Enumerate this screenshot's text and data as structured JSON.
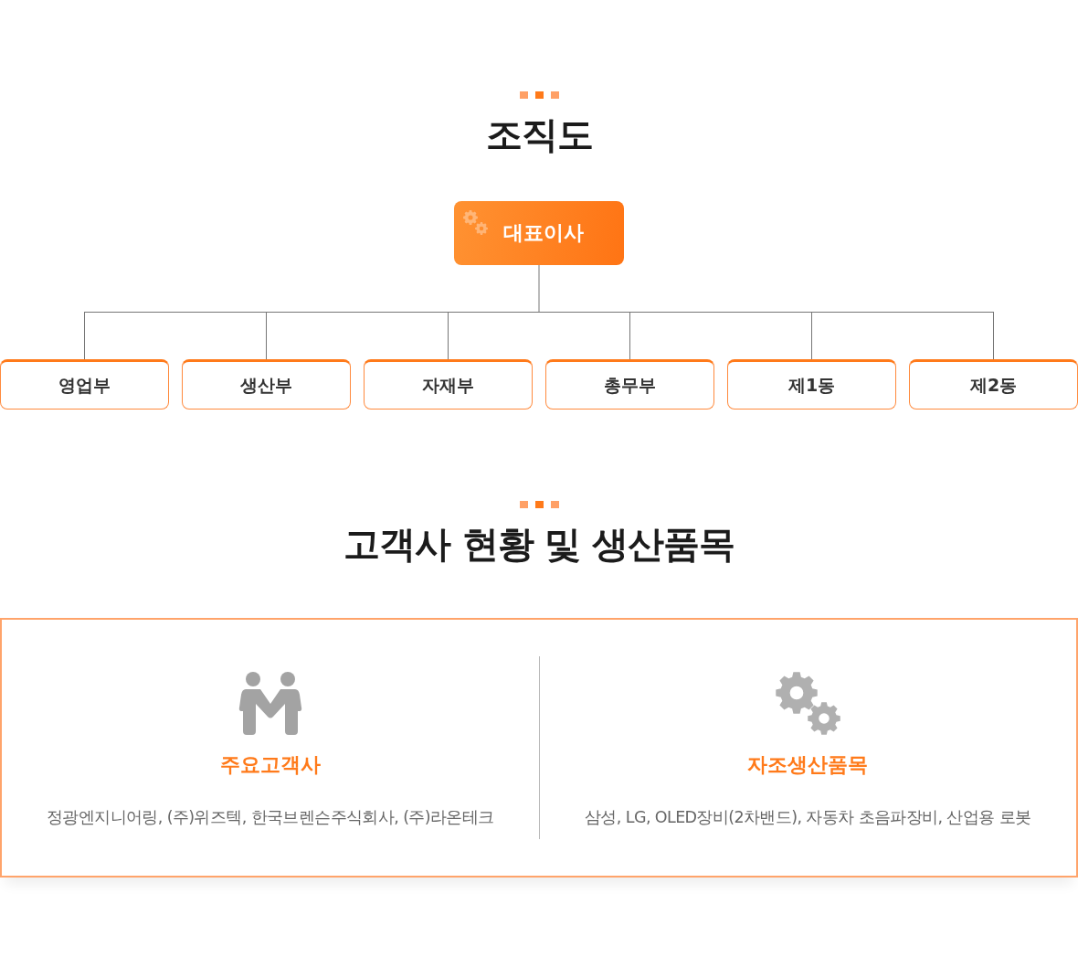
{
  "org_section": {
    "title": "조직도"
  },
  "org_chart": {
    "head": "대표이사",
    "departments": [
      "영업부",
      "생산부",
      "자재부",
      "총무부",
      "제1동",
      "제2동"
    ]
  },
  "clients_section": {
    "title": "고객사 현황 및 생산품목"
  },
  "info_cards": [
    {
      "kind": "clients",
      "heading": "주요고객사",
      "text": "정광엔지니어링, (주)위즈텍, 한국브렌슨주식회사, (주)라온테크"
    },
    {
      "kind": "products",
      "heading": "자조생산품목",
      "text": "삼성, LG, OLED장비(2차밴드), 자동차 초음파장비, 산업용 로봇"
    }
  ]
}
